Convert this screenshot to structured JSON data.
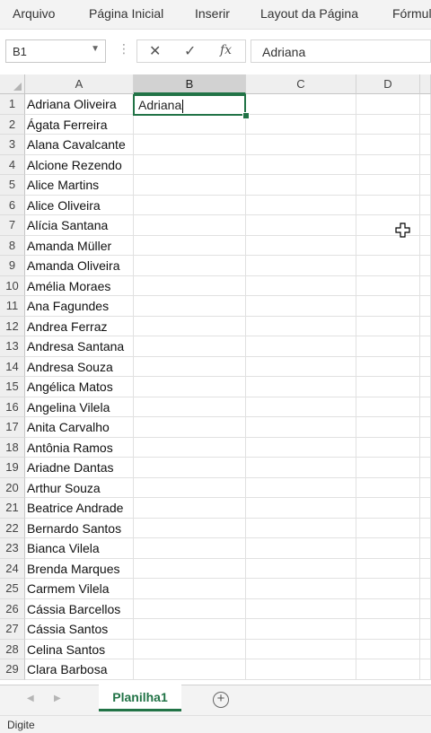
{
  "ribbon": {
    "tabs": [
      "Arquivo",
      "Página Inicial",
      "Inserir",
      "Layout da Página",
      "Fórmul"
    ]
  },
  "formula_bar": {
    "name_box": "B1",
    "cancel_icon": "close-icon",
    "enter_icon": "check-icon",
    "function_label": "fx",
    "value": "Adriana"
  },
  "grid": {
    "columns": [
      "A",
      "B",
      "C",
      "D"
    ],
    "active_column": "B",
    "rows": [
      {
        "n": "1",
        "a": "Adriana Oliveira"
      },
      {
        "n": "2",
        "a": "Ágata Ferreira"
      },
      {
        "n": "3",
        "a": "Alana Cavalcante"
      },
      {
        "n": "4",
        "a": "Alcione Rezendo"
      },
      {
        "n": "5",
        "a": "Alice Martins"
      },
      {
        "n": "6",
        "a": "Alice Oliveira"
      },
      {
        "n": "7",
        "a": "Alícia Santana"
      },
      {
        "n": "8",
        "a": "Amanda Müller"
      },
      {
        "n": "9",
        "a": "Amanda Oliveira"
      },
      {
        "n": "10",
        "a": "Amélia Moraes"
      },
      {
        "n": "11",
        "a": "Ana Fagundes"
      },
      {
        "n": "12",
        "a": "Andrea Ferraz"
      },
      {
        "n": "13",
        "a": "Andresa Santana"
      },
      {
        "n": "14",
        "a": "Andresa Souza"
      },
      {
        "n": "15",
        "a": "Angélica Matos"
      },
      {
        "n": "16",
        "a": "Angelina Vilela"
      },
      {
        "n": "17",
        "a": "Anita Carvalho"
      },
      {
        "n": "18",
        "a": "Antônia Ramos"
      },
      {
        "n": "19",
        "a": "Ariadne Dantas"
      },
      {
        "n": "20",
        "a": "Arthur Souza"
      },
      {
        "n": "21",
        "a": "Beatrice Andrade"
      },
      {
        "n": "22",
        "a": "Bernardo Santos"
      },
      {
        "n": "23",
        "a": "Bianca Vilela"
      },
      {
        "n": "24",
        "a": "Brenda Marques"
      },
      {
        "n": "25",
        "a": "Carmem Vilela"
      },
      {
        "n": "26",
        "a": "Cássia Barcellos"
      },
      {
        "n": "27",
        "a": "Cássia Santos"
      },
      {
        "n": "28",
        "a": "Celina Santos"
      },
      {
        "n": "29",
        "a": "Clara Barbosa"
      }
    ],
    "editing_cell": {
      "ref": "B1",
      "value": "Adriana"
    }
  },
  "sheet_tabs": {
    "active": "Planilha1",
    "add_icon": "add-sheet-icon"
  },
  "status_bar": {
    "mode": "Digite"
  },
  "colors": {
    "accent": "#217346",
    "header_bg": "#efefef",
    "ribbon_bg": "#f3f3f3"
  }
}
